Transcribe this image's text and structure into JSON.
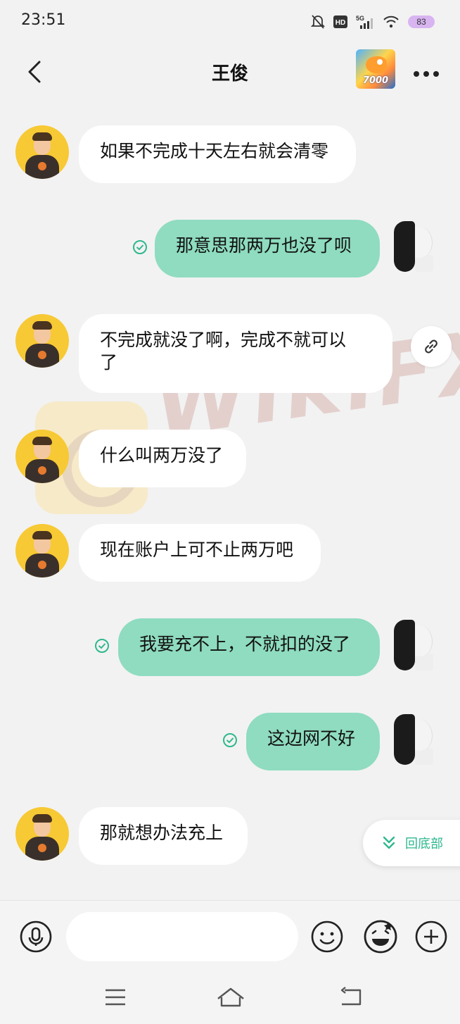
{
  "status_bar": {
    "time": "23:51",
    "battery": "83",
    "network": "5G"
  },
  "header": {
    "title": "王俊",
    "avatar_text": "7000"
  },
  "messages": [
    {
      "side": "in",
      "text": "如果不完成十天左右就会清零"
    },
    {
      "side": "out",
      "text": "那意思那两万也没了呗"
    },
    {
      "side": "in",
      "text": "不完成就没了啊，完成不就可以\n了"
    },
    {
      "side": "in",
      "text": "什么叫两万没了"
    },
    {
      "side": "in",
      "text": "现在账户上可不止两万吧"
    },
    {
      "side": "out",
      "text": "我要充不上，不就扣的没了"
    },
    {
      "side": "out",
      "text": "这边网不好"
    },
    {
      "side": "in",
      "text": "那就想办法充上"
    }
  ],
  "scroll_to_bottom": {
    "label": "回底部"
  },
  "input": {
    "placeholder": "",
    "value": ""
  },
  "watermark": {
    "text": "WikiFX"
  },
  "colors": {
    "accent": "#2eb88e",
    "outgoing_bubble": "#8fdcc0",
    "incoming_bubble": "#ffffff",
    "avatar_bg": "#f7c934"
  }
}
